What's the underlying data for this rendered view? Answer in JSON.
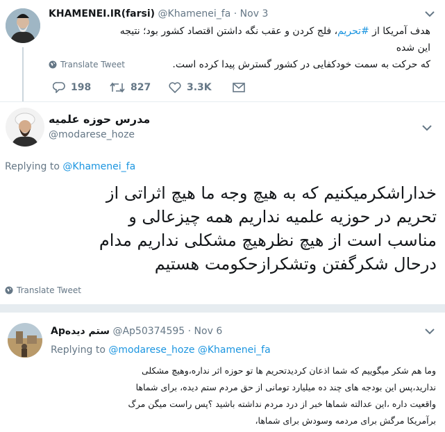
{
  "tweet1": {
    "name": "KHAMENEI.IR(farsi)",
    "handle": "@Khamenei_fa",
    "date": "· Nov 3",
    "text_line1_pre": "هدف آمریکا از ",
    "hashtag": "#تحریم",
    "text_line1_post": "، فلج کردن و عقب نگه داشتن اقتصاد کشور بود؛ نتیجه این شده",
    "text_line2": "که حرکت به سمت خودکفایی در کشور گسترش پیدا کرده است.",
    "translate": "Translate Tweet",
    "replies": "198",
    "retweets": "827",
    "likes": "3.3K"
  },
  "tweet2": {
    "name": "مدرس حوزه علمیه",
    "handle": "@modarese_hoze",
    "replying_label": "Replying to",
    "replying_to": "@Khamenei_fa",
    "text_lines": [
      "خداراشکرمیکنیم که به هیچ وجه ما هیچ اثراتی از",
      "تحریم در حوزیه علمیه نداریم همه چیزعالی و",
      "مناسب است از هیچ نظرهیچ مشکلی نداریم مدام",
      "درحال شکرگفتن وتشکرازحکومت هستیم"
    ],
    "translate": "Translate Tweet"
  },
  "tweet3": {
    "name": "Apستم دیده",
    "handle": "@Ap50374595",
    "date": "· Nov 6",
    "replying_label": "Replying to",
    "replying_to": "@modarese_hoze @Khamenei_fa",
    "text_lines": [
      "وما هم شکر میگوییم که شما اذعان کردیدتحریم ها تو حوزه اثر نداره،وهیچ مشکلی",
      "ندارید،پس این بودجه های چند ده میلیارد تومانی از حق مردم ستم دیده، برای شماها",
      "واقعیت داره ،این عدالته شماها خبر از درد مردم نداشته باشید ؟پس راست میگن مرگ",
      "برآمریکا  مرگش برای مردمه وسودش برای شماها،"
    ]
  },
  "colors": {
    "link": "#1b95e0",
    "muted": "#657786",
    "divider": "#e6ecf0"
  },
  "icons": {
    "globe": "globe-icon",
    "reply": "reply-icon",
    "retweet": "retweet-icon",
    "like": "heart-icon",
    "dm": "envelope-icon",
    "chevron": "chevron-down-icon"
  }
}
